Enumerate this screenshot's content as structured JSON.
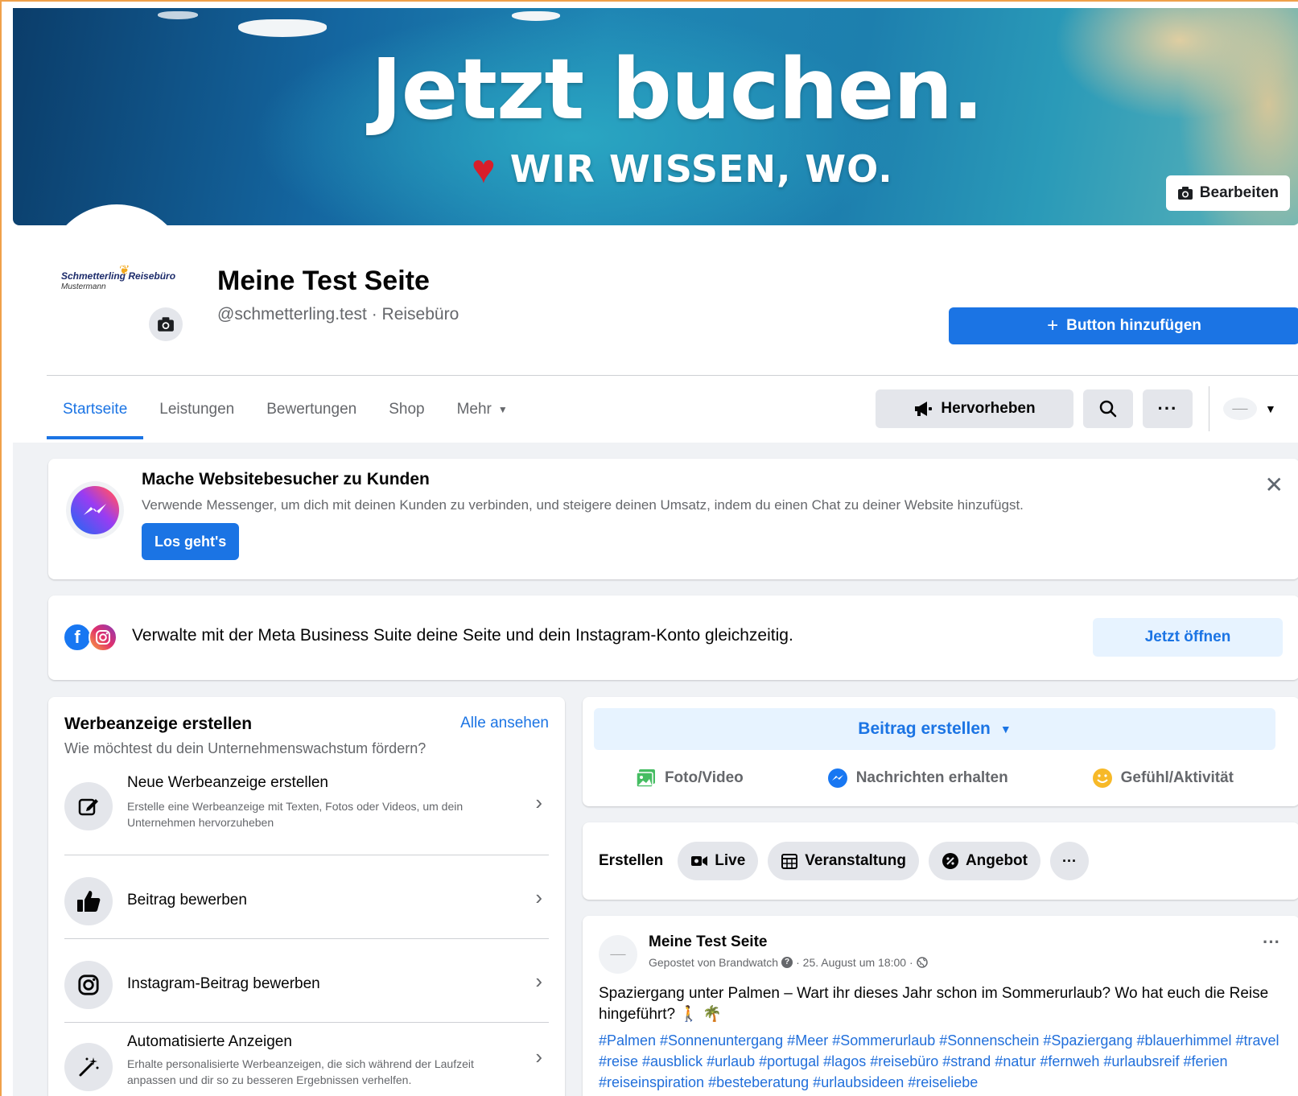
{
  "cover": {
    "title": "Jetzt buchen.",
    "subtitle": "WIR WISSEN, WO.",
    "edit_label": "Bearbeiten"
  },
  "profile": {
    "logo_text": "Schmetterling Reisebüro",
    "logo_sub": "Mustermann",
    "name": "Meine Test Seite",
    "handle": "@schmetterling.test · Reisebüro",
    "add_button_label": "Button hinzufügen"
  },
  "tabs": [
    {
      "label": "Startseite",
      "active": true
    },
    {
      "label": "Leistungen"
    },
    {
      "label": "Bewertungen"
    },
    {
      "label": "Shop"
    },
    {
      "label": "Mehr"
    }
  ],
  "actions": {
    "promote_label": "Hervorheben",
    "search_icon": "search-icon",
    "more_icon": "more-icon"
  },
  "messenger_card": {
    "title": "Mache Websitebesucher zu Kunden",
    "text": "Verwende Messenger, um dich mit deinen Kunden zu verbinden, und steigere deinen Umsatz, indem du einen Chat zu deiner Website hinzufügst.",
    "button_label": "Los geht's"
  },
  "meta_card": {
    "text": "Verwalte mit der Meta Business Suite deine Seite und dein Instagram-Konto gleichzeitig.",
    "button_label": "Jetzt öffnen"
  },
  "ads": {
    "title": "Werbeanzeige erstellen",
    "see_all": "Alle ansehen",
    "subtitle": "Wie möchtest du dein Unternehmenswachstum fördern?",
    "items": [
      {
        "title": "Neue Werbeanzeige erstellen",
        "desc": "Erstelle eine Werbeanzeige mit Texten, Fotos oder Videos, um dein Unternehmen hervorzuheben",
        "icon": "edit-icon"
      },
      {
        "title": "Beitrag bewerben",
        "desc": "",
        "icon": "thumbs-up-icon"
      },
      {
        "title": "Instagram-Beitrag bewerben",
        "desc": "",
        "icon": "instagram-icon"
      },
      {
        "title": "Automatisierte Anzeigen",
        "desc": "Erhalte personalisierte Werbeanzeigen, die sich während der Laufzeit anpassen und dir so zu besseren Ergebnissen verhelfen.",
        "icon": "magic-wand-icon"
      }
    ]
  },
  "composer": {
    "create_label": "Beitrag erstellen",
    "photo_label": "Foto/Video",
    "messages_label": "Nachrichten erhalten",
    "feeling_label": "Gefühl/Aktivität"
  },
  "quick": {
    "label": "Erstellen",
    "live": "Live",
    "event": "Veranstaltung",
    "offer": "Angebot"
  },
  "post": {
    "author": "Meine Test Seite",
    "meta_posted_by": "Gepostet von Brandwatch",
    "meta_date": "· 25. August um 18:00 ·",
    "text": "Spaziergang unter Palmen – Wart ihr dieses Jahr schon im Sommerurlaub? Wo hat euch die Reise hingeführt? 🚶 🌴",
    "hashtags": "#Palmen #Sonnenuntergang #Meer #Sommerurlaub #Sonnenschein #Spaziergang #blauerhimmel #travel #reise #ausblick #urlaub #portugal #lagos #reisebüro #strand #natur #fernweh #urlaubsreif #ferien #reiseinspiration #besteberatung #urlaubsideen #reiseliebe"
  },
  "colors": {
    "accent": "#1b74e4",
    "accent_light": "#e7f3ff",
    "feed_bg": "#f0f2f5"
  }
}
